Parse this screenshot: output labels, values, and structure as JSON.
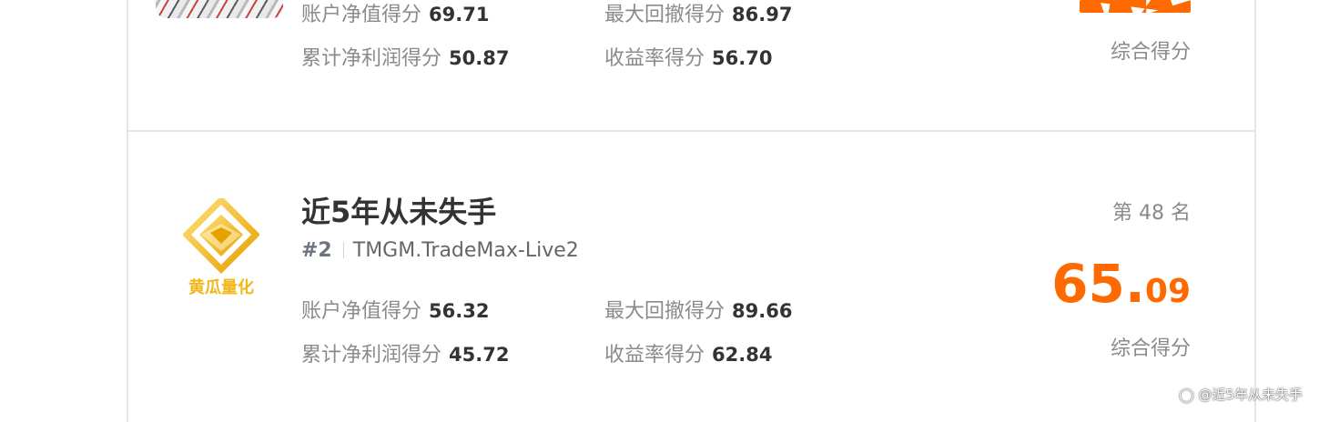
{
  "prev_card": {
    "metrics": {
      "equity_label": "账户净值得分",
      "equity_value": "69.71",
      "drawdown_label": "最大回撤得分",
      "drawdown_value": "86.97",
      "profit_label": "累计净利润得分",
      "profit_value": "50.87",
      "return_label": "收益率得分",
      "return_value": "56.70"
    },
    "score_label": "综合得分"
  },
  "card": {
    "title": "近5年从未失手",
    "account_number": "#2",
    "account_name": "TMGM.TradeMax-Live2",
    "logo_text": "黄瓜量化",
    "rank_text": "第 48 名",
    "score_int": "65",
    "score_dot": ".",
    "score_dec": "09",
    "score_label": "综合得分",
    "metrics": {
      "equity_label": "账户净值得分",
      "equity_value": "56.32",
      "drawdown_label": "最大回撤得分",
      "drawdown_value": "89.66",
      "profit_label": "累计净利润得分",
      "profit_value": "45.72",
      "return_label": "收益率得分",
      "return_value": "62.84"
    }
  },
  "watermark": "@近5年从未失手",
  "colors": {
    "accent": "#ff6a00",
    "logo_gold": "#f0b81a",
    "label_gray": "#8a8a8a"
  }
}
